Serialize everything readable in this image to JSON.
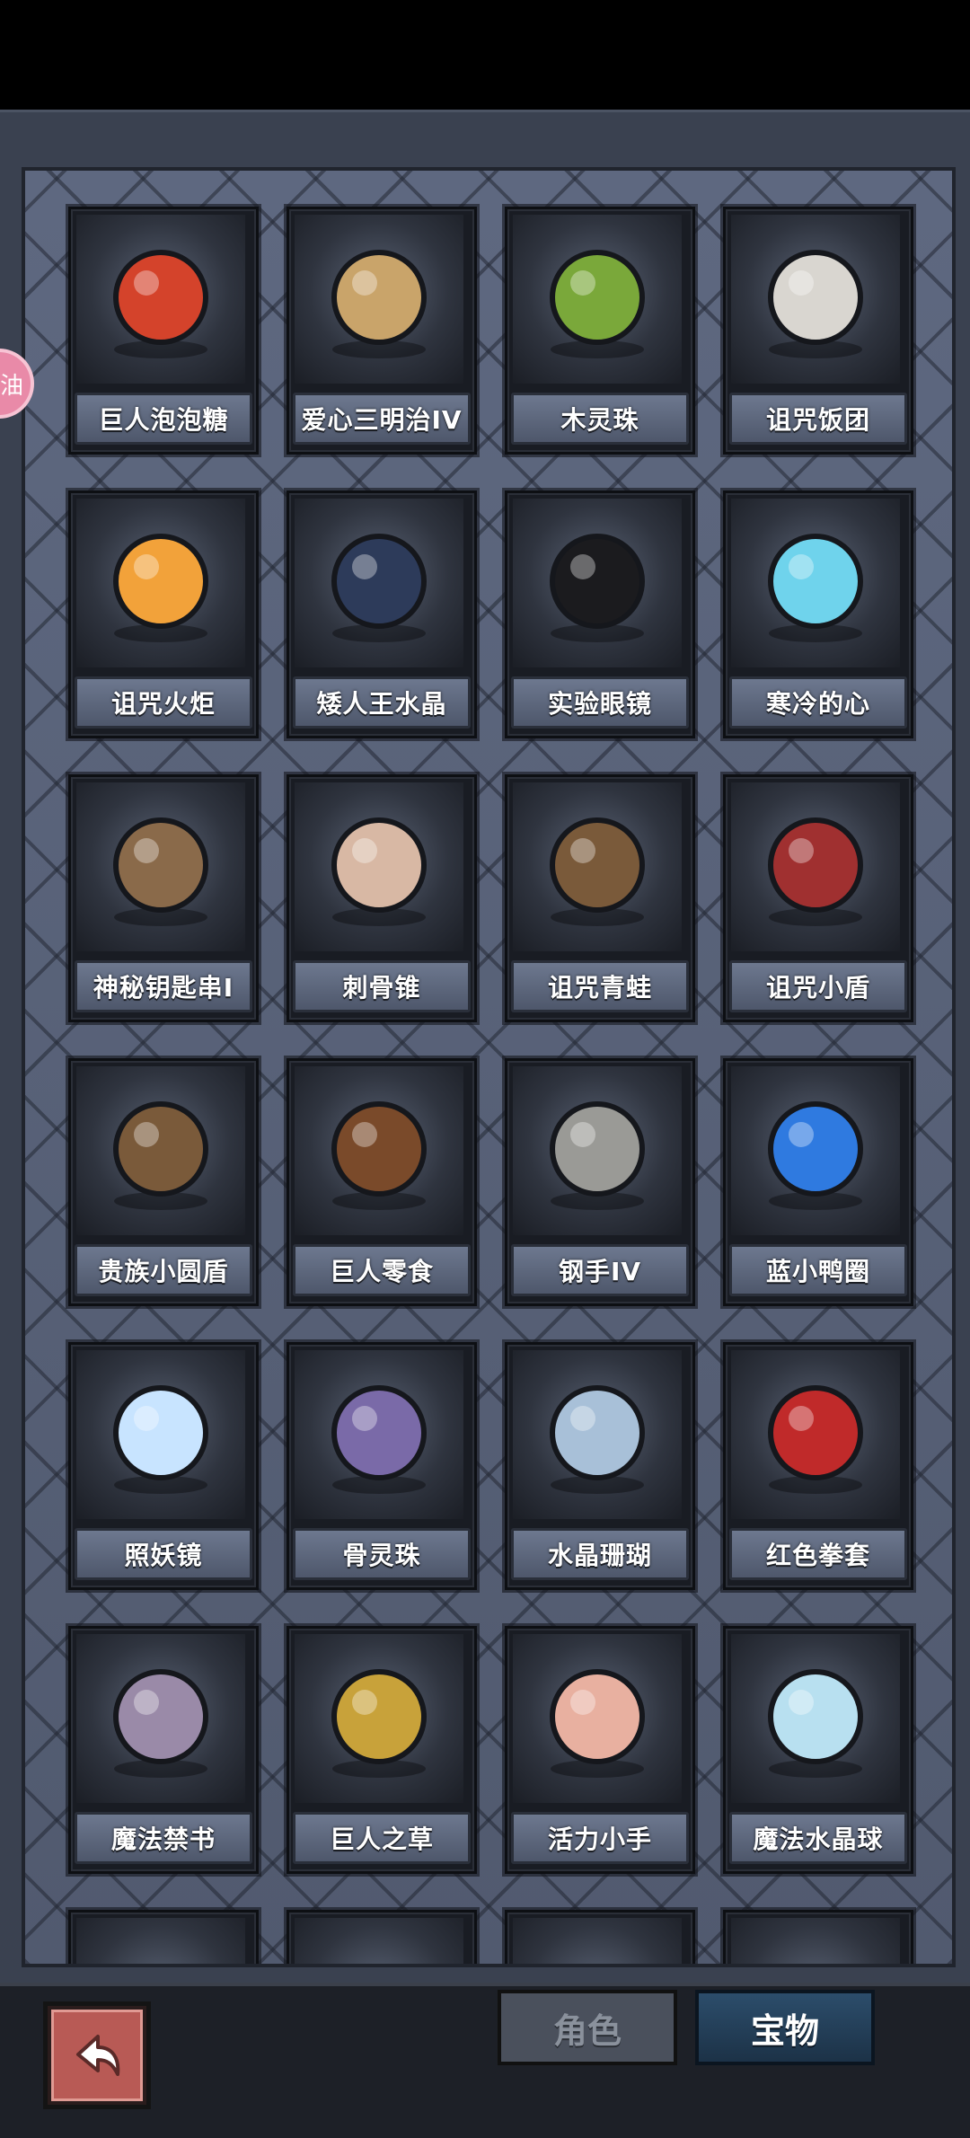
{
  "items": [
    {
      "label": "巨人泡泡糖",
      "icon": "bubblegum-box-icon",
      "color": "#d4432b"
    },
    {
      "label": "爱心三明治IV",
      "icon": "heart-sandwich-icon",
      "color": "#c9a46a"
    },
    {
      "label": "木灵珠",
      "icon": "wood-spirit-orb-icon",
      "color": "#7aa83a"
    },
    {
      "label": "诅咒饭团",
      "icon": "cursed-riceball-icon",
      "color": "#d9d6d0"
    },
    {
      "label": "诅咒火炬",
      "icon": "cursed-torch-icon",
      "color": "#f2a23a"
    },
    {
      "label": "矮人王水晶",
      "icon": "dwarf-crystal-heart-icon",
      "color": "#2d3b5a"
    },
    {
      "label": "实验眼镜",
      "icon": "lab-goggles-icon",
      "color": "#1b1b1e"
    },
    {
      "label": "寒冷的心",
      "icon": "cold-heart-icon",
      "color": "#6fd3ec"
    },
    {
      "label": "神秘钥匙串I",
      "icon": "key-ring-icon",
      "color": "#8a6a4a"
    },
    {
      "label": "刺骨锥",
      "icon": "bone-spike-icon",
      "color": "#d8b8a4"
    },
    {
      "label": "诅咒青蛙",
      "icon": "cursed-frog-icon",
      "color": "#7a5a3a"
    },
    {
      "label": "诅咒小盾",
      "icon": "cursed-shield-icon",
      "color": "#a03030"
    },
    {
      "label": "贵族小圆盾",
      "icon": "round-shield-icon",
      "color": "#7a5a3a"
    },
    {
      "label": "巨人零食",
      "icon": "giant-snack-icon",
      "color": "#7a4a2a"
    },
    {
      "label": "钢手IV",
      "icon": "steel-gauntlet-icon",
      "color": "#9a9a96"
    },
    {
      "label": "蓝小鸭圈",
      "icon": "duck-swim-ring-icon",
      "color": "#2f7ae0"
    },
    {
      "label": "照妖镜",
      "icon": "demon-mirror-icon",
      "color": "#c8e4ff"
    },
    {
      "label": "骨灵珠",
      "icon": "bone-spirit-orb-icon",
      "color": "#7a6aa8"
    },
    {
      "label": "水晶珊瑚",
      "icon": "crystal-coral-icon",
      "color": "#a8c0d8"
    },
    {
      "label": "红色拳套",
      "icon": "red-boxing-glove-icon",
      "color": "#c02a2a"
    },
    {
      "label": "魔法禁书",
      "icon": "forbidden-book-icon",
      "color": "#9a8aa8"
    },
    {
      "label": "巨人之草",
      "icon": "giant-grass-icon",
      "color": "#c8a23a"
    },
    {
      "label": "活力小手",
      "icon": "vitality-hand-icon",
      "color": "#e8b0a0"
    },
    {
      "label": "魔法水晶球",
      "icon": "crystal-ball-icon",
      "color": "#b8e0f0"
    }
  ],
  "partial_row": [
    "partial-item-icon",
    "partial-item-icon",
    "partial-item-icon",
    "partial-item-icon"
  ],
  "side_badge": "油",
  "tabs": {
    "role": "角色",
    "treasure": "宝物"
  },
  "back_icon": "back-arrow-icon"
}
